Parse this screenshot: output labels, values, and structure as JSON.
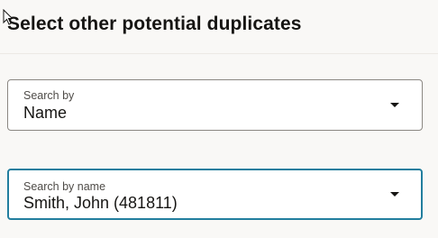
{
  "header": {
    "title": "Select other potential duplicates"
  },
  "search_by": {
    "label": "Search by",
    "value": "Name",
    "icon": "chevron-down-icon"
  },
  "search_by_name": {
    "label": "Search by name",
    "value": "Smith, John (481811)",
    "icon": "chevron-down-icon"
  },
  "colors": {
    "background": "#f9f8f6",
    "border": "#8b8782",
    "focus_border": "#227e9e",
    "text": "#161513",
    "label_text": "#4f4c48"
  }
}
